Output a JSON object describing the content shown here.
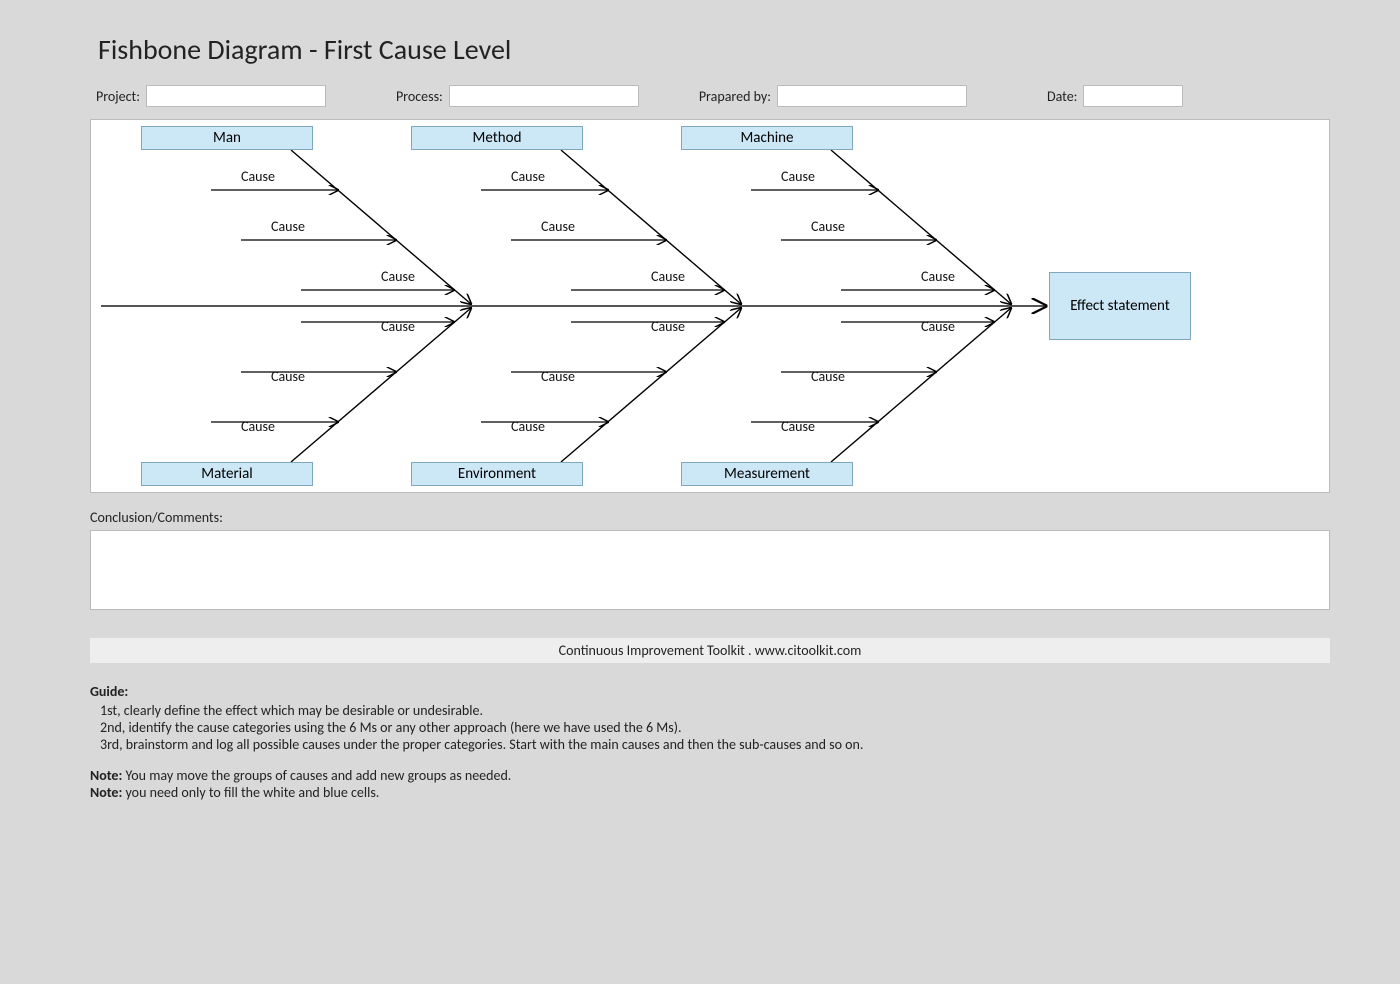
{
  "title": "Fishbone Diagram - First Cause Level",
  "form": {
    "project_label": "Project:",
    "process_label": "Process:",
    "prepared_by_label": "Prapared by:",
    "date_label": "Date:",
    "project_value": "",
    "process_value": "",
    "prepared_by_value": "",
    "date_value": ""
  },
  "categories": {
    "top": [
      "Man",
      "Method",
      "Machine"
    ],
    "bottom": [
      "Material",
      "Environment",
      "Measurement"
    ]
  },
  "effect_label": "Effect statement",
  "cause_label": "Cause",
  "conclusion_label": "Conclusion/Comments:",
  "footer": "Continuous Improvement Toolkit . www.citoolkit.com",
  "guide": {
    "heading": "Guide:",
    "steps": [
      "1st, clearly define the effect which may be desirable or undesirable.",
      "2nd, identify the cause categories using the 6 Ms or any other approach (here we have used the 6 Ms).",
      "3rd, brainstorm and log all possible causes under the proper categories. Start with the main causes and then the sub-causes and so on."
    ]
  },
  "notes": [
    {
      "prefix": "Note:",
      "text": " You may move the groups of causes and add new groups as needed."
    },
    {
      "prefix": "Note:",
      "text": " you need only to fill the white and blue cells."
    }
  ]
}
